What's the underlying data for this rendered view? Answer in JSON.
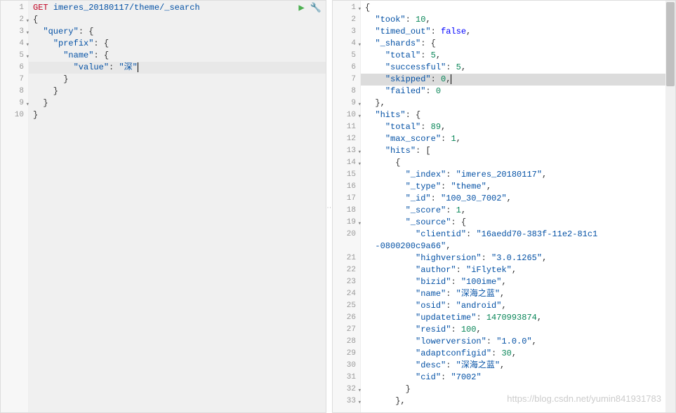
{
  "left": {
    "method": "GET",
    "path": "imeres_20180117/theme/_search",
    "lines": [
      {
        "n": 1,
        "fold": false,
        "hl": false,
        "tokens": [
          [
            "m",
            "GET "
          ],
          [
            "s",
            "imeres_20180117/theme/_search"
          ]
        ]
      },
      {
        "n": 2,
        "fold": true,
        "hl": false,
        "tokens": [
          [
            "p",
            "{"
          ]
        ]
      },
      {
        "n": 3,
        "fold": true,
        "hl": false,
        "tokens": [
          [
            "p",
            "  "
          ],
          [
            "k",
            "\"query\""
          ],
          [
            "p",
            ": {"
          ]
        ]
      },
      {
        "n": 4,
        "fold": true,
        "hl": false,
        "tokens": [
          [
            "p",
            "    "
          ],
          [
            "k",
            "\"prefix\""
          ],
          [
            "p",
            ": {"
          ]
        ]
      },
      {
        "n": 5,
        "fold": true,
        "hl": false,
        "tokens": [
          [
            "p",
            "      "
          ],
          [
            "k",
            "\"name\""
          ],
          [
            "p",
            ": {"
          ]
        ]
      },
      {
        "n": 6,
        "fold": false,
        "hl": true,
        "tokens": [
          [
            "p",
            "        "
          ],
          [
            "k",
            "\"value\""
          ],
          [
            "p",
            ": "
          ],
          [
            "k",
            "\"深\""
          ]
        ]
      },
      {
        "n": 7,
        "fold": false,
        "hl": false,
        "tokens": [
          [
            "p",
            "      }"
          ]
        ]
      },
      {
        "n": 8,
        "fold": false,
        "hl": false,
        "tokens": [
          [
            "p",
            "    }"
          ]
        ]
      },
      {
        "n": 9,
        "fold": true,
        "hl": false,
        "tokens": [
          [
            "p",
            "  }"
          ]
        ]
      },
      {
        "n": 10,
        "fold": false,
        "hl": false,
        "tokens": [
          [
            "p",
            "}"
          ]
        ]
      }
    ]
  },
  "right": {
    "lines": [
      {
        "n": 1,
        "fold": true,
        "hl": false,
        "tokens": [
          [
            "p",
            "{"
          ]
        ]
      },
      {
        "n": 2,
        "fold": false,
        "hl": false,
        "tokens": [
          [
            "p",
            "  "
          ],
          [
            "k",
            "\"took\""
          ],
          [
            "p",
            ": "
          ],
          [
            "n",
            "10"
          ],
          [
            "p",
            ","
          ]
        ]
      },
      {
        "n": 3,
        "fold": false,
        "hl": false,
        "tokens": [
          [
            "p",
            "  "
          ],
          [
            "k",
            "\"timed_out\""
          ],
          [
            "p",
            ": "
          ],
          [
            "b",
            "false"
          ],
          [
            "p",
            ","
          ]
        ]
      },
      {
        "n": 4,
        "fold": true,
        "hl": false,
        "tokens": [
          [
            "p",
            "  "
          ],
          [
            "k",
            "\"_shards\""
          ],
          [
            "p",
            ": {"
          ]
        ]
      },
      {
        "n": 5,
        "fold": false,
        "hl": false,
        "tokens": [
          [
            "p",
            "    "
          ],
          [
            "k",
            "\"total\""
          ],
          [
            "p",
            ": "
          ],
          [
            "n",
            "5"
          ],
          [
            "p",
            ","
          ]
        ]
      },
      {
        "n": 6,
        "fold": false,
        "hl": false,
        "tokens": [
          [
            "p",
            "    "
          ],
          [
            "k",
            "\"successful\""
          ],
          [
            "p",
            ": "
          ],
          [
            "n",
            "5"
          ],
          [
            "p",
            ","
          ]
        ]
      },
      {
        "n": 7,
        "fold": false,
        "hl": true,
        "tokens": [
          [
            "p",
            "    "
          ],
          [
            "k",
            "\"skipped\""
          ],
          [
            "p",
            ": "
          ],
          [
            "n",
            "0"
          ],
          [
            "p",
            ","
          ]
        ]
      },
      {
        "n": 8,
        "fold": false,
        "hl": false,
        "tokens": [
          [
            "p",
            "    "
          ],
          [
            "k",
            "\"failed\""
          ],
          [
            "p",
            ": "
          ],
          [
            "n",
            "0"
          ]
        ]
      },
      {
        "n": 9,
        "fold": true,
        "hl": false,
        "tokens": [
          [
            "p",
            "  },"
          ]
        ]
      },
      {
        "n": 10,
        "fold": true,
        "hl": false,
        "tokens": [
          [
            "p",
            "  "
          ],
          [
            "k",
            "\"hits\""
          ],
          [
            "p",
            ": {"
          ]
        ]
      },
      {
        "n": 11,
        "fold": false,
        "hl": false,
        "tokens": [
          [
            "p",
            "    "
          ],
          [
            "k",
            "\"total\""
          ],
          [
            "p",
            ": "
          ],
          [
            "n",
            "89"
          ],
          [
            "p",
            ","
          ]
        ]
      },
      {
        "n": 12,
        "fold": false,
        "hl": false,
        "tokens": [
          [
            "p",
            "    "
          ],
          [
            "k",
            "\"max_score\""
          ],
          [
            "p",
            ": "
          ],
          [
            "n",
            "1"
          ],
          [
            "p",
            ","
          ]
        ]
      },
      {
        "n": 13,
        "fold": true,
        "hl": false,
        "tokens": [
          [
            "p",
            "    "
          ],
          [
            "k",
            "\"hits\""
          ],
          [
            "p",
            ": ["
          ]
        ]
      },
      {
        "n": 14,
        "fold": true,
        "hl": false,
        "tokens": [
          [
            "p",
            "      {"
          ]
        ]
      },
      {
        "n": 15,
        "fold": false,
        "hl": false,
        "tokens": [
          [
            "p",
            "        "
          ],
          [
            "k",
            "\"_index\""
          ],
          [
            "p",
            ": "
          ],
          [
            "k",
            "\"imeres_20180117\""
          ],
          [
            "p",
            ","
          ]
        ]
      },
      {
        "n": 16,
        "fold": false,
        "hl": false,
        "tokens": [
          [
            "p",
            "        "
          ],
          [
            "k",
            "\"_type\""
          ],
          [
            "p",
            ": "
          ],
          [
            "k",
            "\"theme\""
          ],
          [
            "p",
            ","
          ]
        ]
      },
      {
        "n": 17,
        "fold": false,
        "hl": false,
        "tokens": [
          [
            "p",
            "        "
          ],
          [
            "k",
            "\"_id\""
          ],
          [
            "p",
            ": "
          ],
          [
            "k",
            "\"100_30_7002\""
          ],
          [
            "p",
            ","
          ]
        ]
      },
      {
        "n": 18,
        "fold": false,
        "hl": false,
        "tokens": [
          [
            "p",
            "        "
          ],
          [
            "k",
            "\"_score\""
          ],
          [
            "p",
            ": "
          ],
          [
            "n",
            "1"
          ],
          [
            "p",
            ","
          ]
        ]
      },
      {
        "n": 19,
        "fold": true,
        "hl": false,
        "tokens": [
          [
            "p",
            "        "
          ],
          [
            "k",
            "\"_source\""
          ],
          [
            "p",
            ": {"
          ]
        ]
      },
      {
        "n": 20,
        "fold": false,
        "hl": false,
        "tokens": [
          [
            "p",
            "          "
          ],
          [
            "k",
            "\"clientid\""
          ],
          [
            "p",
            ": "
          ],
          [
            "k",
            "\"16aedd70-383f-11e2-81c1"
          ]
        ]
      },
      {
        "n": "",
        "fold": false,
        "hl": false,
        "tokens": [
          [
            "k",
            "  -0800200c9a66\""
          ],
          [
            "p",
            ","
          ]
        ]
      },
      {
        "n": 21,
        "fold": false,
        "hl": false,
        "tokens": [
          [
            "p",
            "          "
          ],
          [
            "k",
            "\"highversion\""
          ],
          [
            "p",
            ": "
          ],
          [
            "k",
            "\"3.0.1265\""
          ],
          [
            "p",
            ","
          ]
        ]
      },
      {
        "n": 22,
        "fold": false,
        "hl": false,
        "tokens": [
          [
            "p",
            "          "
          ],
          [
            "k",
            "\"author\""
          ],
          [
            "p",
            ": "
          ],
          [
            "k",
            "\"iFlytek\""
          ],
          [
            "p",
            ","
          ]
        ]
      },
      {
        "n": 23,
        "fold": false,
        "hl": false,
        "tokens": [
          [
            "p",
            "          "
          ],
          [
            "k",
            "\"bizid\""
          ],
          [
            "p",
            ": "
          ],
          [
            "k",
            "\"100ime\""
          ],
          [
            "p",
            ","
          ]
        ]
      },
      {
        "n": 24,
        "fold": false,
        "hl": false,
        "tokens": [
          [
            "p",
            "          "
          ],
          [
            "k",
            "\"name\""
          ],
          [
            "p",
            ": "
          ],
          [
            "k",
            "\"深海之蓝\""
          ],
          [
            "p",
            ","
          ]
        ]
      },
      {
        "n": 25,
        "fold": false,
        "hl": false,
        "tokens": [
          [
            "p",
            "          "
          ],
          [
            "k",
            "\"osid\""
          ],
          [
            "p",
            ": "
          ],
          [
            "k",
            "\"android\""
          ],
          [
            "p",
            ","
          ]
        ]
      },
      {
        "n": 26,
        "fold": false,
        "hl": false,
        "tokens": [
          [
            "p",
            "          "
          ],
          [
            "k",
            "\"updatetime\""
          ],
          [
            "p",
            ": "
          ],
          [
            "n",
            "1470993874"
          ],
          [
            "p",
            ","
          ]
        ]
      },
      {
        "n": 27,
        "fold": false,
        "hl": false,
        "tokens": [
          [
            "p",
            "          "
          ],
          [
            "k",
            "\"resid\""
          ],
          [
            "p",
            ": "
          ],
          [
            "n",
            "100"
          ],
          [
            "p",
            ","
          ]
        ]
      },
      {
        "n": 28,
        "fold": false,
        "hl": false,
        "tokens": [
          [
            "p",
            "          "
          ],
          [
            "k",
            "\"lowerversion\""
          ],
          [
            "p",
            ": "
          ],
          [
            "k",
            "\"1.0.0\""
          ],
          [
            "p",
            ","
          ]
        ]
      },
      {
        "n": 29,
        "fold": false,
        "hl": false,
        "tokens": [
          [
            "p",
            "          "
          ],
          [
            "k",
            "\"adaptconfigid\""
          ],
          [
            "p",
            ": "
          ],
          [
            "n",
            "30"
          ],
          [
            "p",
            ","
          ]
        ]
      },
      {
        "n": 30,
        "fold": false,
        "hl": false,
        "tokens": [
          [
            "p",
            "          "
          ],
          [
            "k",
            "\"desc\""
          ],
          [
            "p",
            ": "
          ],
          [
            "k",
            "\"深海之蓝\""
          ],
          [
            "p",
            ","
          ]
        ]
      },
      {
        "n": 31,
        "fold": false,
        "hl": false,
        "tokens": [
          [
            "p",
            "          "
          ],
          [
            "k",
            "\"cid\""
          ],
          [
            "p",
            ": "
          ],
          [
            "k",
            "\"7002\""
          ]
        ]
      },
      {
        "n": 32,
        "fold": true,
        "hl": false,
        "tokens": [
          [
            "p",
            "        }"
          ]
        ]
      },
      {
        "n": 33,
        "fold": true,
        "hl": false,
        "tokens": [
          [
            "p",
            "      },"
          ]
        ]
      }
    ]
  },
  "watermark": "https://blog.csdn.net/yumin841931783"
}
